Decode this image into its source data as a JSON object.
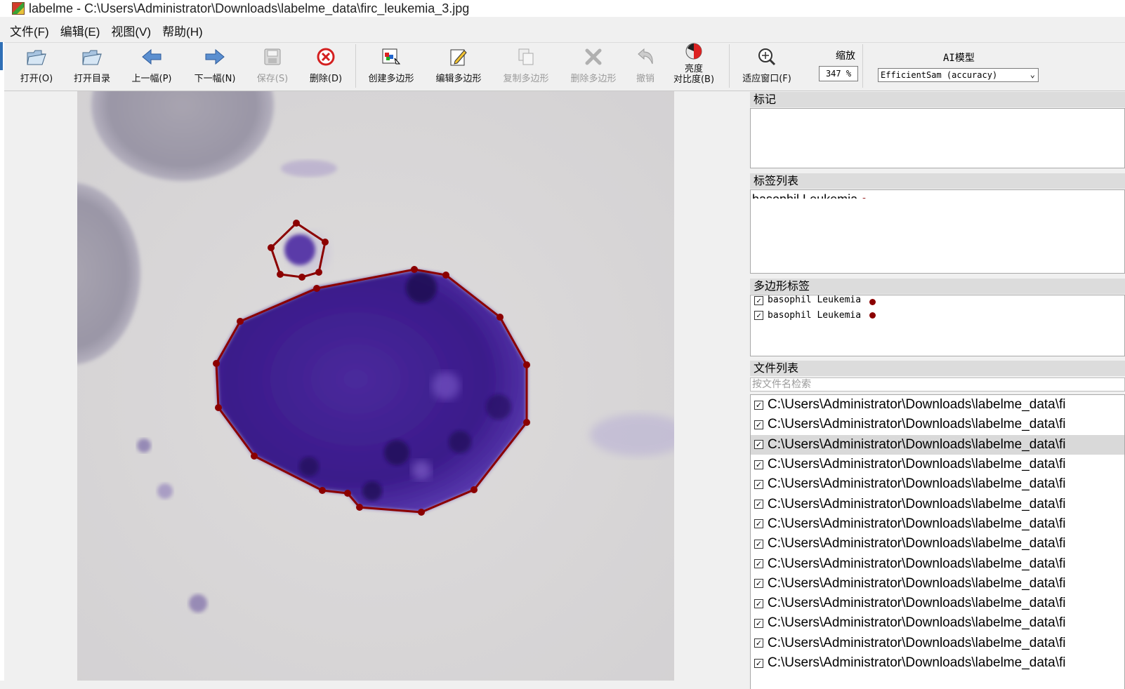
{
  "window": {
    "title": "labelme - C:\\Users\\Administrator\\Downloads\\labelme_data\\firc_leukemia_3.jpg"
  },
  "menubar": {
    "items": [
      "文件(F)",
      "编辑(E)",
      "视图(V)",
      "帮助(H)"
    ]
  },
  "toolbar": {
    "open": "打开(O)",
    "open_dir": "打开目录",
    "prev": "上一幅(P)",
    "next": "下一幅(N)",
    "save": "保存(S)",
    "delete": "删除(D)",
    "create_polygon": "创建多边形",
    "edit_polygon": "编辑多边形",
    "copy_polygon": "复制多边形",
    "delete_polygon": "删除多边形",
    "undo": "撤销",
    "brightness_line1": "亮度",
    "brightness_line2": "对比度(B)",
    "fit_window": "适应窗口(F)",
    "zoom_title": "缩放",
    "zoom_value": "347 %",
    "ai_title": "AI模型",
    "ai_model": "EfficientSam (accuracy)"
  },
  "dock": {
    "flags_title": "标记",
    "label_list_title": "标签列表",
    "label_list": [
      {
        "text": "basophil Leukemia",
        "color": "#8b0000"
      }
    ],
    "polygon_labels_title": "多边形标签",
    "polygon_labels": [
      {
        "text": "basophil Leukemia",
        "checked": true,
        "color": "#8b0000"
      },
      {
        "text": "basophil Leukemia",
        "checked": true,
        "color": "#8b0000"
      }
    ],
    "file_list_title": "文件列表",
    "file_search_placeholder": "按文件名检索",
    "files": [
      "C:\\Users\\Administrator\\Downloads\\labelme_data\\fi",
      "C:\\Users\\Administrator\\Downloads\\labelme_data\\fi",
      "C:\\Users\\Administrator\\Downloads\\labelme_data\\fi",
      "C:\\Users\\Administrator\\Downloads\\labelme_data\\fi",
      "C:\\Users\\Administrator\\Downloads\\labelme_data\\fi",
      "C:\\Users\\Administrator\\Downloads\\labelme_data\\fi",
      "C:\\Users\\Administrator\\Downloads\\labelme_data\\fi",
      "C:\\Users\\Administrator\\Downloads\\labelme_data\\fi",
      "C:\\Users\\Administrator\\Downloads\\labelme_data\\fi",
      "C:\\Users\\Administrator\\Downloads\\labelme_data\\fi",
      "C:\\Users\\Administrator\\Downloads\\labelme_data\\fi",
      "C:\\Users\\Administrator\\Downloads\\labelme_data\\fi",
      "C:\\Users\\Administrator\\Downloads\\labelme_data\\fi",
      "C:\\Users\\Administrator\\Downloads\\labelme_data\\fi"
    ],
    "selected_file_index": 2
  },
  "colors": {
    "polygon": "#8b0000",
    "cell": "#3a1a8a",
    "background": "#d9d7d6"
  }
}
